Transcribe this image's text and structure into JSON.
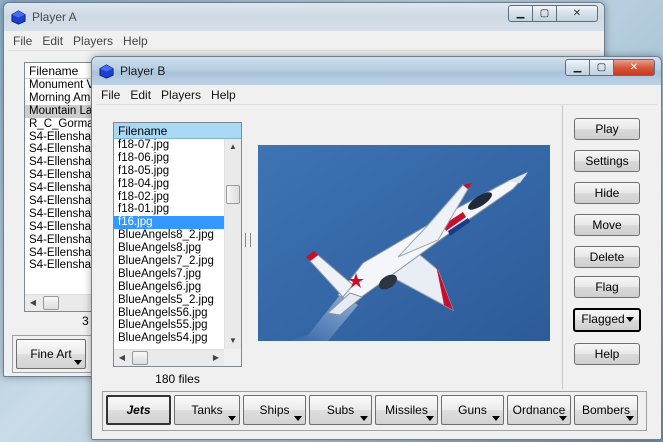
{
  "window_a": {
    "title": "Player A",
    "menu": [
      "File",
      "Edit",
      "Players",
      "Help"
    ],
    "list_header": "Filename",
    "rows": [
      "Monument V",
      "Morning Amo",
      "Mountain Lal",
      "R_C_Gormar",
      "S4-Ellenshav",
      "S4-Ellenshav",
      "S4-Ellenshav",
      "S4-Ellenshav",
      "S4-Ellenshav",
      "S4-Ellenshav",
      "S4-Ellenshav",
      "S4-Ellenshav",
      "S4-Ellenshav",
      "S4-Ellenshav",
      "S4-Ellenshav"
    ],
    "selected_index": 2,
    "status_fragment": "3",
    "tab_visible": "Fine Art"
  },
  "window_b": {
    "title": "Player B",
    "menu": [
      "File",
      "Edit",
      "Players",
      "Help"
    ],
    "list_header": "Filename",
    "rows": [
      "f18-07.jpg",
      "f18-06.jpg",
      "f18-05.jpg",
      "f18-04.jpg",
      "f18-02.jpg",
      "f18-01.jpg",
      "f16.jpg",
      "BlueAngels8_2.jpg",
      "BlueAngels8.jpg",
      "BlueAngels7_2.jpg",
      "BlueAngels7.jpg",
      "BlueAngels6.jpg",
      "BlueAngels5_2.jpg",
      "BlueAngels56.jpg",
      "BlueAngels55.jpg",
      "BlueAngels54.jpg"
    ],
    "selected_index": 6,
    "file_count": "180 files",
    "buttons": {
      "play": "Play",
      "settings": "Settings",
      "hide": "Hide",
      "move": "Move",
      "delete": "Delete",
      "flag": "Flag",
      "flagged": "Flagged",
      "help": "Help"
    },
    "tabs": [
      "Jets",
      "Tanks",
      "Ships",
      "Subs",
      "Missiles",
      "Guns",
      "Ordnance",
      "Bombers"
    ],
    "active_tab": "Jets"
  },
  "colors": {
    "sky": "#3a6aa8",
    "selection": "#3399ff",
    "header": "#a9d8f4"
  }
}
